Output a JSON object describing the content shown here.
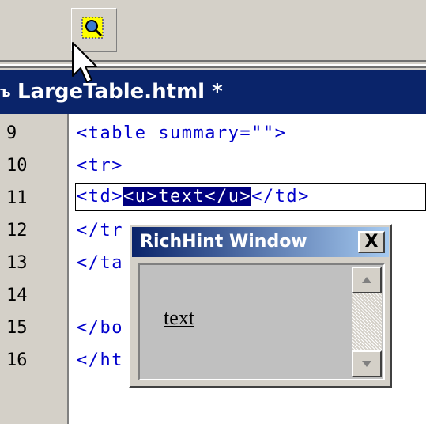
{
  "toolbar": {
    "button_icon": "magnifier-icon"
  },
  "document": {
    "tab_icon": "html-file-icon",
    "tab_icon_glyph": "ъ",
    "title": "LargeTable.html *"
  },
  "editor": {
    "lines": [
      {
        "num": "9",
        "code": "<table summary=\"\">"
      },
      {
        "num": "10",
        "code": "<tr>"
      },
      {
        "num": "11",
        "code_before": "<td>",
        "code_sel": "<u>text</u>",
        "code_after": "</td>"
      },
      {
        "num": "12",
        "code": "</tr"
      },
      {
        "num": "13",
        "code": "</ta"
      },
      {
        "num": "14",
        "code": ""
      },
      {
        "num": "15",
        "code": "</bo"
      },
      {
        "num": "16",
        "code": "</ht"
      }
    ]
  },
  "hint_window": {
    "title": "RichHint Window",
    "close_label": "X",
    "content": "text"
  },
  "colors": {
    "title_bar": "#0a246a",
    "code_text": "#0000cc",
    "selection": "#000080"
  }
}
